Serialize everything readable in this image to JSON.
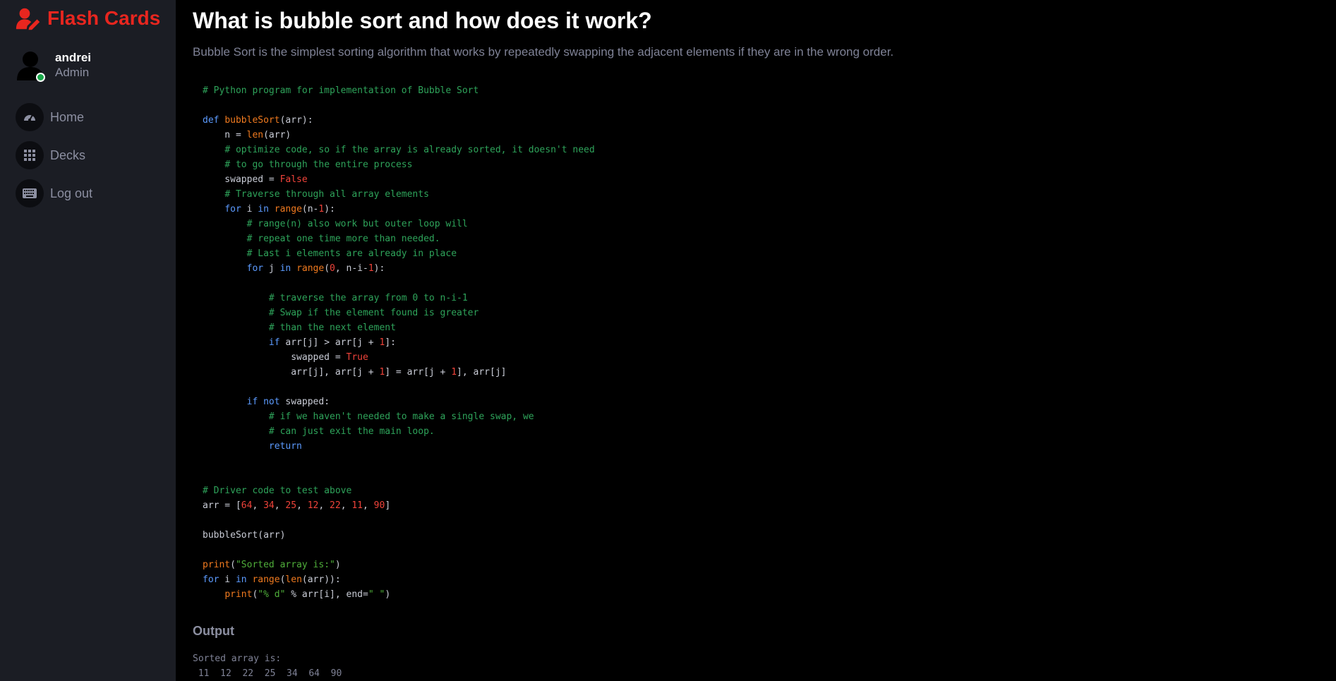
{
  "colors": {
    "sidebar_bg": "#1b1d24",
    "main_bg": "#000000",
    "brand": "#e8261f",
    "status_online": "#19a84a"
  },
  "sidebar": {
    "brand_label": "Flash Cards",
    "brand_icon": "user-edit-icon",
    "user": {
      "name": "andrei",
      "role": "Admin",
      "status": "online"
    },
    "nav_items": [
      {
        "label": "Home",
        "icon": "tachometer-icon"
      },
      {
        "label": "Decks",
        "icon": "grid-icon"
      },
      {
        "label": "Log out",
        "icon": "keyboard-icon"
      }
    ]
  },
  "main": {
    "title": "What is bubble sort and how does it work?",
    "description": "Bubble Sort is the simplest sorting algorithm that works by repeatedly swapping the adjacent elements if they are in the wrong order.",
    "code_lines": [
      [
        {
          "t": "# Python program for implementation of Bubble Sort",
          "c": "com"
        }
      ],
      [],
      [
        {
          "t": "def",
          "c": "kw"
        },
        {
          "t": " "
        },
        {
          "t": "bubbleSort",
          "c": "fn"
        },
        {
          "t": "(arr):"
        }
      ],
      [
        {
          "t": "    n = "
        },
        {
          "t": "len",
          "c": "fn"
        },
        {
          "t": "(arr)"
        }
      ],
      [
        {
          "t": "    "
        },
        {
          "t": "# optimize code, so if the array is already sorted, it doesn't need",
          "c": "com"
        }
      ],
      [
        {
          "t": "    "
        },
        {
          "t": "# to go through the entire process",
          "c": "com"
        }
      ],
      [
        {
          "t": "    swapped = "
        },
        {
          "t": "False",
          "c": "num"
        }
      ],
      [
        {
          "t": "    "
        },
        {
          "t": "# Traverse through all array elements",
          "c": "com"
        }
      ],
      [
        {
          "t": "    "
        },
        {
          "t": "for",
          "c": "kw"
        },
        {
          "t": " i "
        },
        {
          "t": "in",
          "c": "kw"
        },
        {
          "t": " "
        },
        {
          "t": "range",
          "c": "fn"
        },
        {
          "t": "(n-"
        },
        {
          "t": "1",
          "c": "num"
        },
        {
          "t": "):"
        }
      ],
      [
        {
          "t": "        "
        },
        {
          "t": "# range(n) also work but outer loop will",
          "c": "com"
        }
      ],
      [
        {
          "t": "        "
        },
        {
          "t": "# repeat one time more than needed.",
          "c": "com"
        }
      ],
      [
        {
          "t": "        "
        },
        {
          "t": "# Last i elements are already in place",
          "c": "com"
        }
      ],
      [
        {
          "t": "        "
        },
        {
          "t": "for",
          "c": "kw"
        },
        {
          "t": " j "
        },
        {
          "t": "in",
          "c": "kw"
        },
        {
          "t": " "
        },
        {
          "t": "range",
          "c": "fn"
        },
        {
          "t": "("
        },
        {
          "t": "0",
          "c": "num"
        },
        {
          "t": ", n-i-"
        },
        {
          "t": "1",
          "c": "num"
        },
        {
          "t": "):"
        }
      ],
      [],
      [
        {
          "t": "            "
        },
        {
          "t": "# traverse the array from 0 to n-i-1",
          "c": "com"
        }
      ],
      [
        {
          "t": "            "
        },
        {
          "t": "# Swap if the element found is greater",
          "c": "com"
        }
      ],
      [
        {
          "t": "            "
        },
        {
          "t": "# than the next element",
          "c": "com"
        }
      ],
      [
        {
          "t": "            "
        },
        {
          "t": "if",
          "c": "kw"
        },
        {
          "t": " arr[j] > arr[j + "
        },
        {
          "t": "1",
          "c": "num"
        },
        {
          "t": "]:"
        }
      ],
      [
        {
          "t": "                swapped = "
        },
        {
          "t": "True",
          "c": "num"
        }
      ],
      [
        {
          "t": "                arr[j], arr[j + "
        },
        {
          "t": "1",
          "c": "num"
        },
        {
          "t": "] = arr[j + "
        },
        {
          "t": "1",
          "c": "num"
        },
        {
          "t": "], arr[j]"
        }
      ],
      [],
      [
        {
          "t": "        "
        },
        {
          "t": "if",
          "c": "kw"
        },
        {
          "t": " "
        },
        {
          "t": "not",
          "c": "kw"
        },
        {
          "t": " swapped:"
        }
      ],
      [
        {
          "t": "            "
        },
        {
          "t": "# if we haven't needed to make a single swap, we",
          "c": "com"
        }
      ],
      [
        {
          "t": "            "
        },
        {
          "t": "# can just exit the main loop.",
          "c": "com"
        }
      ],
      [
        {
          "t": "            "
        },
        {
          "t": "return",
          "c": "kw"
        }
      ],
      [],
      [],
      [
        {
          "t": "# Driver code to test above",
          "c": "com"
        }
      ],
      [
        {
          "t": "arr = ["
        },
        {
          "t": "64",
          "c": "num"
        },
        {
          "t": ", "
        },
        {
          "t": "34",
          "c": "num"
        },
        {
          "t": ", "
        },
        {
          "t": "25",
          "c": "num"
        },
        {
          "t": ", "
        },
        {
          "t": "12",
          "c": "num"
        },
        {
          "t": ", "
        },
        {
          "t": "22",
          "c": "num"
        },
        {
          "t": ", "
        },
        {
          "t": "11",
          "c": "num"
        },
        {
          "t": ", "
        },
        {
          "t": "90",
          "c": "num"
        },
        {
          "t": "]"
        }
      ],
      [],
      [
        {
          "t": "bubbleSort(arr)"
        }
      ],
      [],
      [
        {
          "t": "print",
          "c": "fn"
        },
        {
          "t": "("
        },
        {
          "t": "\"Sorted array is:\"",
          "c": "str"
        },
        {
          "t": ")"
        }
      ],
      [
        {
          "t": "for",
          "c": "kw"
        },
        {
          "t": " i "
        },
        {
          "t": "in",
          "c": "kw"
        },
        {
          "t": " "
        },
        {
          "t": "range",
          "c": "fn"
        },
        {
          "t": "("
        },
        {
          "t": "len",
          "c": "fn"
        },
        {
          "t": "(arr)):"
        }
      ],
      [
        {
          "t": "    "
        },
        {
          "t": "print",
          "c": "fn"
        },
        {
          "t": "("
        },
        {
          "t": "\"% d\"",
          "c": "str"
        },
        {
          "t": " % arr[i], end="
        },
        {
          "t": "\" \"",
          "c": "str"
        },
        {
          "t": ")"
        }
      ]
    ],
    "output_label": "Output",
    "output_lines": [
      "Sorted array is:",
      " 11  12  22  25  34  64  90"
    ]
  }
}
